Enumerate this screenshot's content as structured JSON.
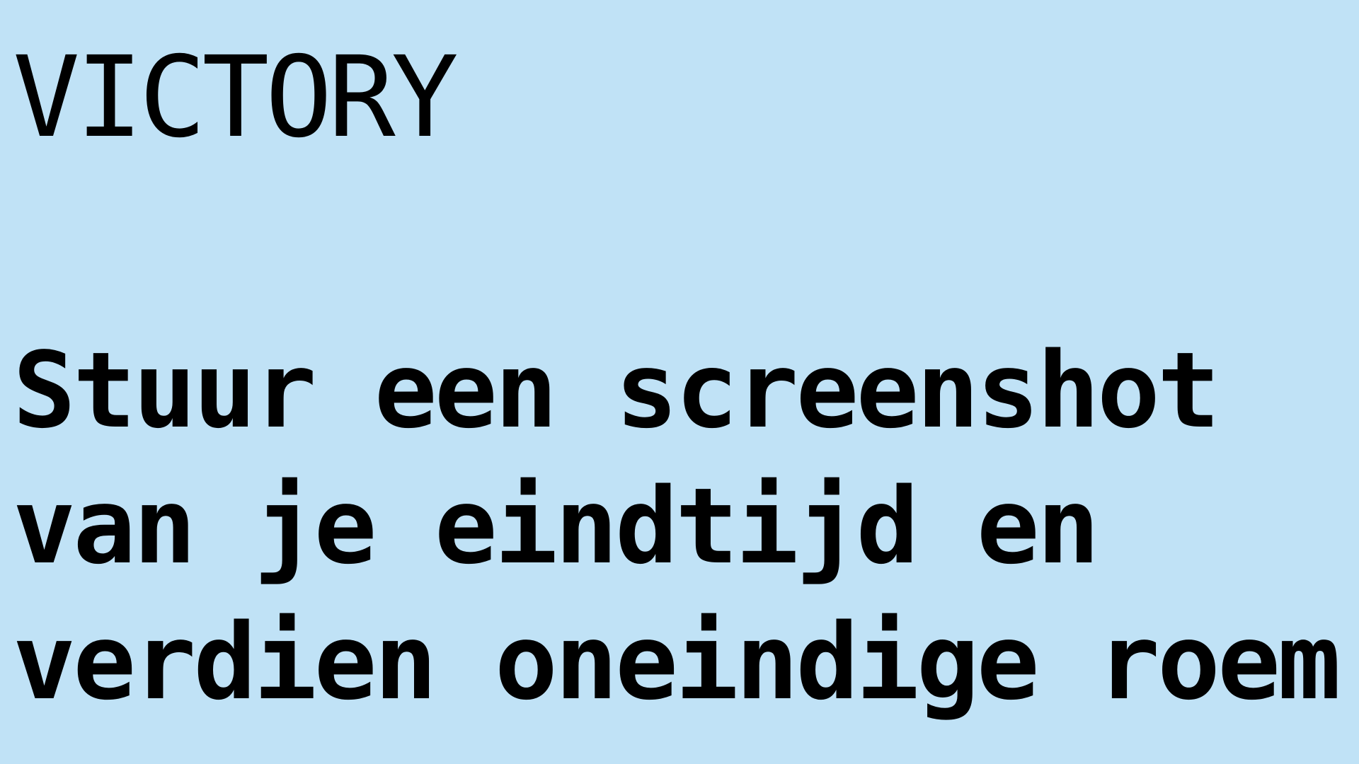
{
  "screen": {
    "title": "VICTORY",
    "message_lines": [
      "Stuur een screenshot",
      "van je eindtijd en",
      "verdien oneindige roem!"
    ]
  },
  "colors": {
    "background": "#c0e2f6",
    "text": "#000000"
  }
}
